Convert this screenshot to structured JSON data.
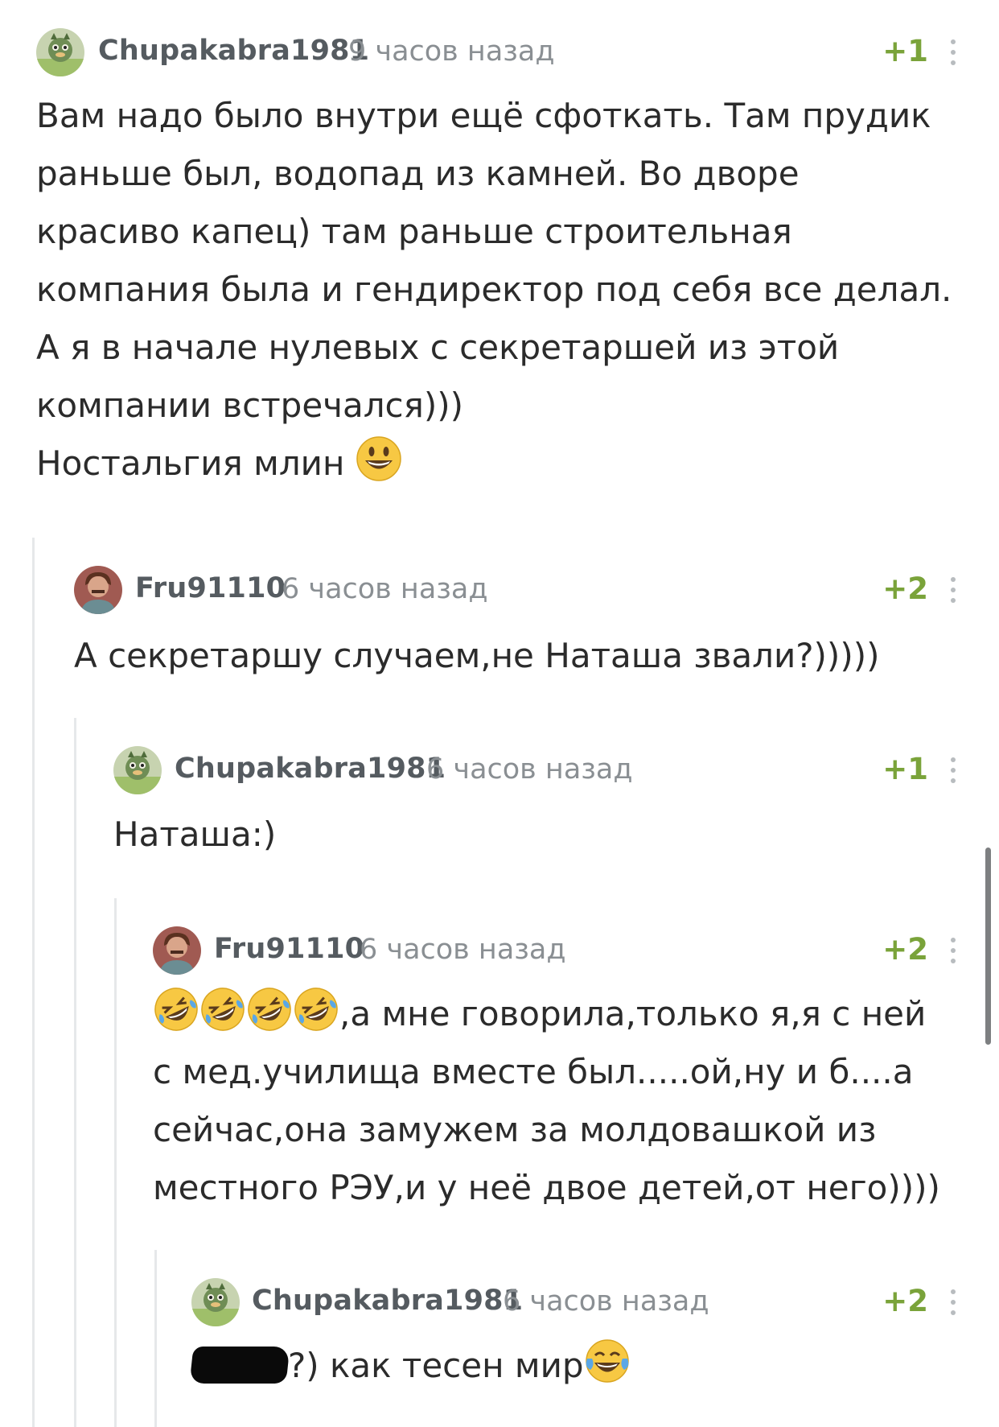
{
  "comments": [
    {
      "username": "Chupakabra1981",
      "time": "9 часов назад",
      "rating": "+1",
      "lines": [
        "Вам надо было внутри ещё сфоткать. Там прудик",
        "раньше был, водопад из камней. Во дворе",
        "красиво капец) там раньше строительная",
        "компания была и гендиректор под себя все делал.",
        "А я в начале нулевых с секретаршей из этой",
        "компании встречался)))",
        "Ностальгия млин"
      ],
      "emoji": "grinning-face-emoji"
    },
    {
      "username": "Fru91110",
      "time": "6 часов назад",
      "rating": "+2",
      "lines": [
        "А секретаршу случаем,не Наташа звали?)))))"
      ]
    },
    {
      "username": "Chupakabra1981",
      "time": "6 часов назад",
      "rating": "+1",
      "lines": [
        "Наташа:)"
      ]
    },
    {
      "username": "Fru91110",
      "time": "6 часов назад",
      "rating": "+2",
      "lines": [
        ",а мне говорила,только я,я с ней",
        "с мед.училища вместе был.....ой,ну и б....а",
        "сейчас,она замужем за молдовашкой из",
        "местного РЭУ,и у неё двое детей,от него))))"
      ],
      "emoji": "rolling-on-floor-laughing-emoji"
    },
    {
      "username": "Chupakabra1981",
      "time": "6 часов назад",
      "rating": "+2",
      "lines": [
        "?) как тесен мир"
      ],
      "emoji": "tears-of-joy-emoji"
    }
  ],
  "colors": {
    "rating": "#7aa33a",
    "username": "#555b60",
    "timestamp": "#8a8f93",
    "thread_line": "#e6e8ea"
  }
}
